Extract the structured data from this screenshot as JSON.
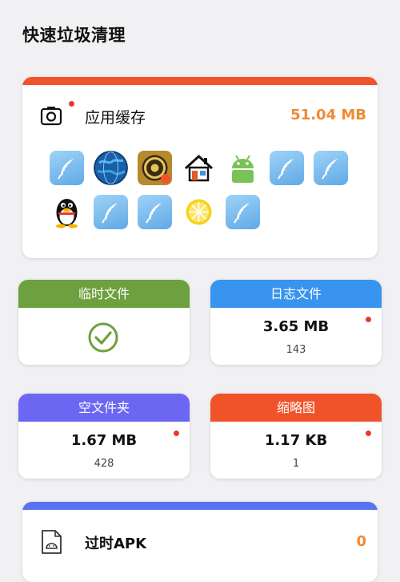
{
  "header": {
    "title": "快速垃圾清理"
  },
  "app_cache": {
    "label": "应用缓存",
    "size": "51.04 MB",
    "apps": [
      {
        "icon": "feather-app-icon"
      },
      {
        "icon": "globe-app-icon"
      },
      {
        "icon": "gold-game-app-icon"
      },
      {
        "icon": "house-app-icon"
      },
      {
        "icon": "android-app-icon"
      },
      {
        "icon": "feather-app-icon"
      },
      {
        "icon": "feather-app-icon"
      },
      {
        "icon": "qq-penguin-app-icon"
      },
      {
        "icon": "feather-app-icon"
      },
      {
        "icon": "feather-app-icon"
      },
      {
        "icon": "lemon-app-icon"
      },
      {
        "icon": "feather-app-icon"
      }
    ]
  },
  "tiles": {
    "temp": {
      "label": "临时文件",
      "status": "clean",
      "color": "#6da03e"
    },
    "log": {
      "label": "日志文件",
      "size": "3.65 MB",
      "count": "143",
      "color": "#3894ee"
    },
    "empty_folders": {
      "label": "空文件夹",
      "size": "1.67 MB",
      "count": "428",
      "color": "#6c67f3"
    },
    "thumbnails": {
      "label": "缩略图",
      "size": "1.17 KB",
      "count": "1",
      "color": "#f0532a"
    }
  },
  "apk": {
    "label": "过时APK",
    "count": "0"
  },
  "colors": {
    "accent_orange": "#f08a33",
    "alert_red": "#e53935"
  }
}
